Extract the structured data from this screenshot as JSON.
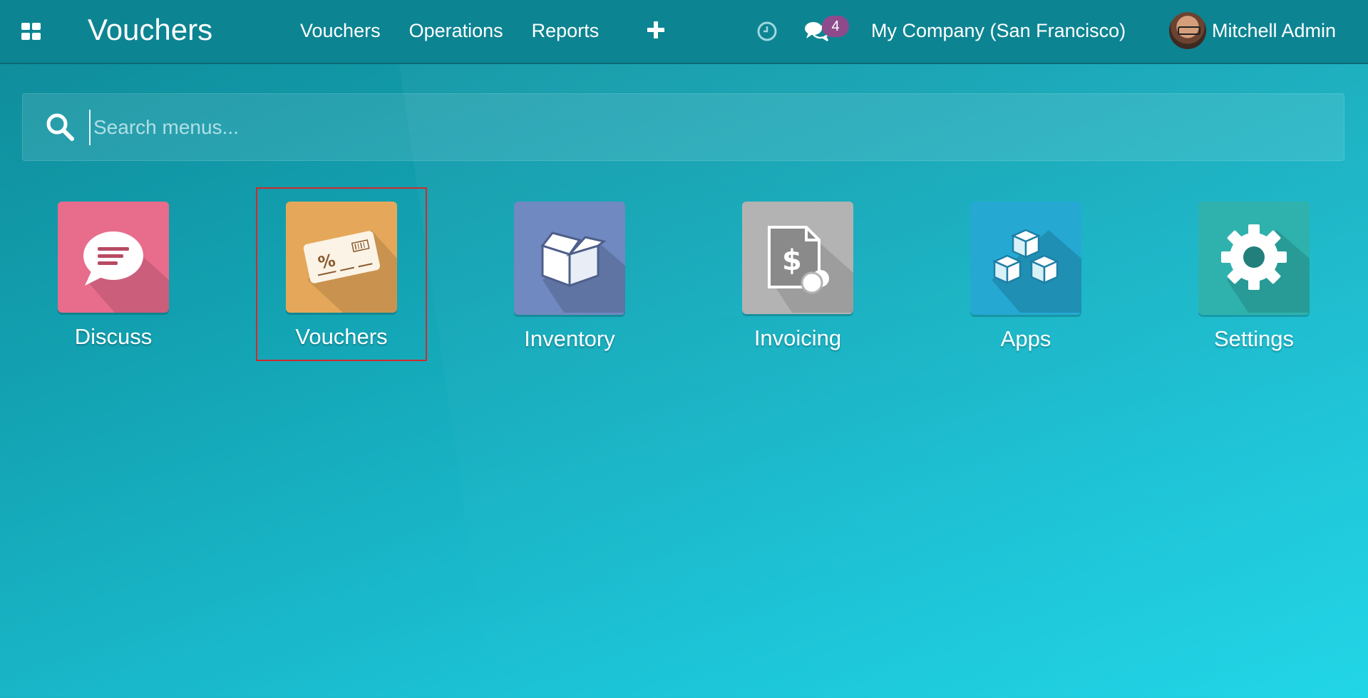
{
  "topbar": {
    "brand": "Vouchers",
    "menu": [
      "Vouchers",
      "Operations",
      "Reports"
    ],
    "messages_count": "4",
    "company": "My Company (San Francisco)",
    "user": "Mitchell Admin"
  },
  "search": {
    "placeholder": "Search menus...",
    "value": ""
  },
  "apps": [
    {
      "label": "Discuss",
      "color": "#e86c8b",
      "icon": "chat-bubble-icon"
    },
    {
      "label": "Vouchers",
      "color": "#e5a85a",
      "icon": "voucher-card-icon",
      "selected": true
    },
    {
      "label": "Inventory",
      "color": "#7089c0",
      "icon": "box-icon"
    },
    {
      "label": "Invoicing",
      "color": "#b3b3b3",
      "icon": "invoice-dollar-icon"
    },
    {
      "label": "Apps",
      "color": "#25a9d3",
      "icon": "cubes-icon"
    },
    {
      "label": "Settings",
      "color": "#2fb2ad",
      "icon": "gear-icon"
    }
  ],
  "colors": {
    "topbar": "#0d8492",
    "badge": "#8d4b8c",
    "selection": "#d22a2a"
  }
}
